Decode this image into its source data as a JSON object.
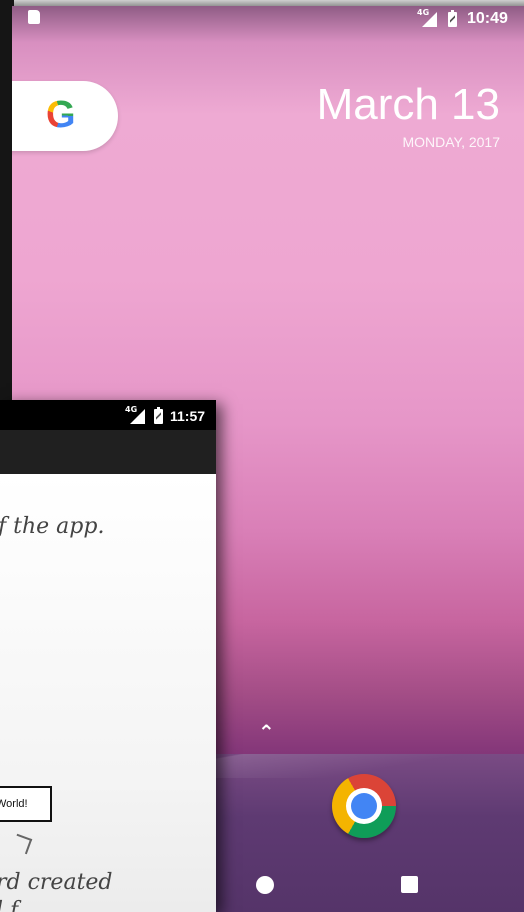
{
  "home": {
    "status_bar": {
      "network": "4G",
      "time": "10:49"
    },
    "date": {
      "main": "March 13",
      "sub": "MONDAY, 2017"
    },
    "search_widget": {
      "logo": "G"
    },
    "dock": {
      "apps": [
        "Chrome"
      ]
    },
    "icons": [
      "sd-card-icon",
      "signal-icon",
      "battery-icon",
      "google-g-icon",
      "chevron-up-icon",
      "chrome-icon",
      "home-nav-icon",
      "recents-nav-icon"
    ]
  },
  "app": {
    "status_bar": {
      "network": "4G",
      "time": "11:57"
    },
    "text_top": "f the app.",
    "hello_button": "World!",
    "text_bottom_1": "rd created",
    "text_bottom_2": "l f"
  },
  "colors": {
    "wallpaper_top": "#eeaad3",
    "wallpaper_bottom": "#5d2b66",
    "app_bar": "#202020"
  }
}
